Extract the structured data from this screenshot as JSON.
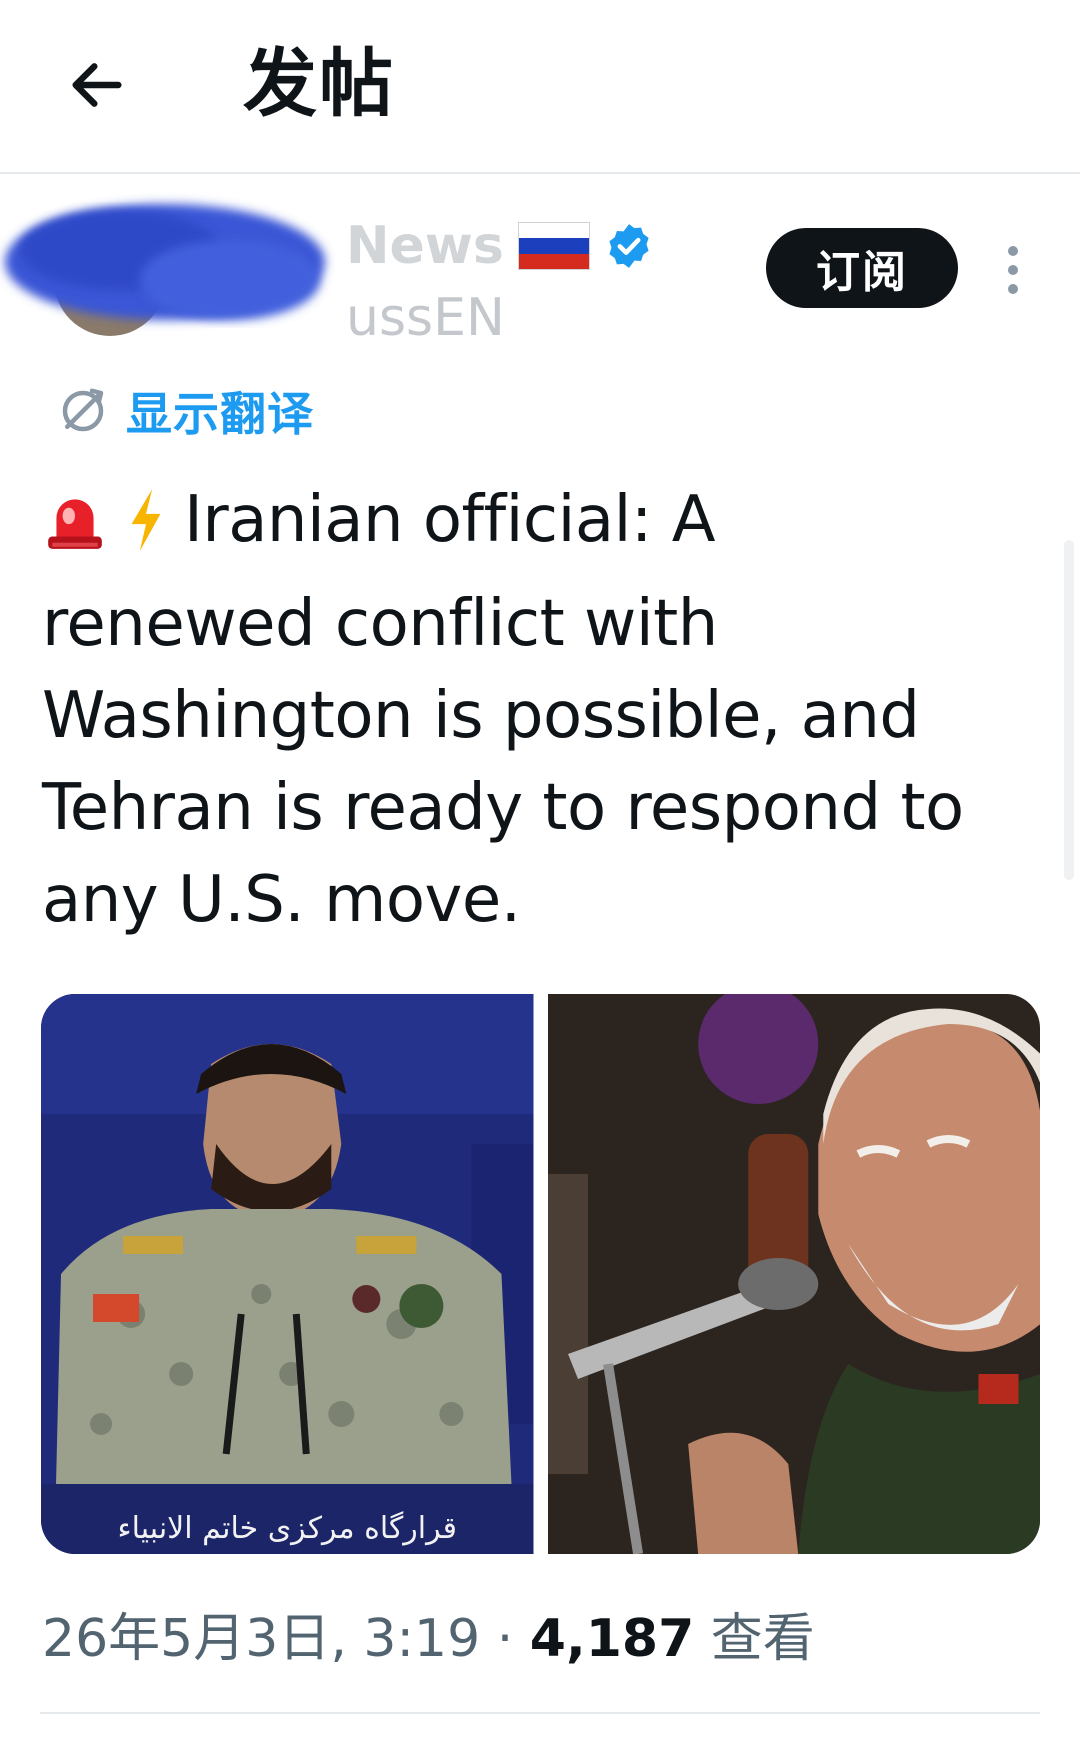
{
  "header": {
    "back_icon": "arrow-left-icon",
    "title": "发帖"
  },
  "author": {
    "display_name": "News",
    "handle": "ussEN",
    "flag_icon": "russia-flag-icon",
    "verified_icon": "verified-badge-icon",
    "subscribe_label": "订阅",
    "more_icon": "more-vertical-icon"
  },
  "translate": {
    "icon": "translate-globe-icon",
    "label": "显示翻译"
  },
  "post": {
    "emoji_1": "siren-icon",
    "emoji_2": "lightning-icon",
    "text": "Iranian official: A renewed conflict with Washington is possible, and Tehran is ready to respond to any U.S. move."
  },
  "media": {
    "left_caption": "قرارگاه مرکزی خاتم الانبیاء"
  },
  "meta": {
    "timestamp": "26年5月3日, 3:19",
    "separator": "·",
    "views_count": "4,187",
    "views_label": "查看"
  },
  "colors": {
    "accent": "#1d9bf0",
    "text": "#0f1419",
    "secondary": "#536471",
    "button_bg": "#0f1419"
  }
}
